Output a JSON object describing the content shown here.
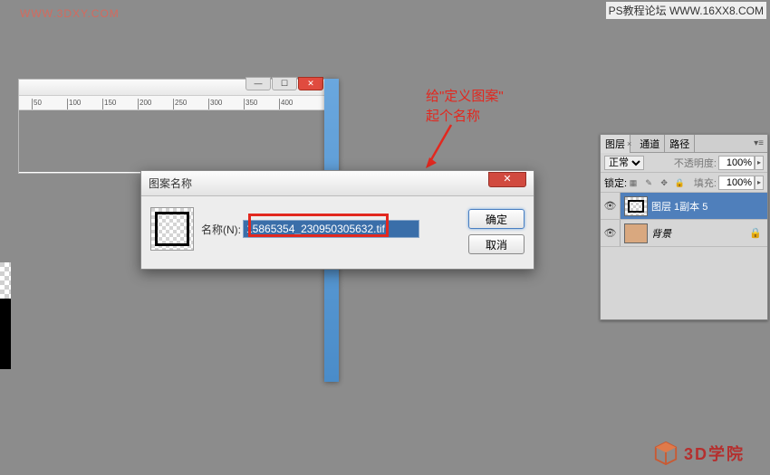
{
  "watermarks": {
    "topleft": "WWW.3DXY.COM",
    "topright": "PS教程论坛 WWW.16XX8.COM",
    "logo": "3D学院"
  },
  "annotation": {
    "line1": "给\"定义图案\"",
    "line2": "起个名称"
  },
  "ruler": [
    "50",
    "100",
    "150",
    "200",
    "250",
    "300",
    "350",
    "400"
  ],
  "dialog": {
    "title": "图案名称",
    "name_label": "名称(N):",
    "name_value": "15865354_230950305632.tif",
    "ok": "确定",
    "cancel": "取消"
  },
  "layers": {
    "tabs": {
      "t1": "图层",
      "t2": "通道",
      "t3": "路径"
    },
    "mode": "正常",
    "opacity_label": "不透明度:",
    "opacity": "100%",
    "lock_label": "锁定:",
    "fill_label": "填充:",
    "fill": "100%",
    "items": [
      {
        "name": "图层 1副本 5"
      },
      {
        "name": "背景"
      }
    ]
  }
}
